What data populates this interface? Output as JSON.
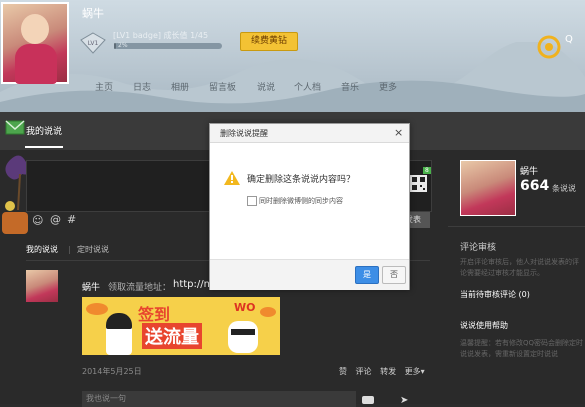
{
  "header": {
    "username": "蜗牛",
    "level_text": "[LV1 badge] 成长值 1/45",
    "progress_label": "2%",
    "progress_value": 0.02,
    "renew_button": "续费黄钻",
    "nav": [
      "主页",
      "日志",
      "相册",
      "留言板",
      "说说",
      "个人档",
      "音乐",
      "更多"
    ],
    "logo_text": "Q"
  },
  "tabs": {
    "my_shuoshuo": "我的说说"
  },
  "composer": {
    "tools": {
      "emoji": "☺",
      "at": "@",
      "topic": "#"
    },
    "publish": "发表",
    "qr_badge": "8"
  },
  "filters": {
    "mine": "我的说说",
    "sep": "|",
    "scheduled": "定时说说"
  },
  "post": {
    "name": "蜗牛",
    "text": "领取流量地址：",
    "link": "http://mqzone.com/rg-0/23",
    "banner": {
      "title1": "签到",
      "title2": "送流量",
      "brand": "WO"
    },
    "date": "2014年5月25日",
    "actions": [
      "赞",
      "评论",
      "转发",
      "更多▾"
    ],
    "comment_placeholder": "我也说一句"
  },
  "side": {
    "name": "蜗牛",
    "count": "664",
    "count_label": "条说说",
    "review_title": "评论审核",
    "review_desc": "开启评论审核后，他人对说说发表的评论需要经过审核才能显示。",
    "pending": "当前待审核评论 (0)",
    "help_title": "说说使用帮助",
    "help_desc": "温馨提醒：若有修改QQ密码会删除定时说说发表，需重新设置定时说说"
  },
  "dialog": {
    "title": "删除说说提醒",
    "close": "×",
    "question": "确定删除这条说说内容吗？",
    "checkbox_label": "同时删除微博侧的同步内容",
    "yes": "是",
    "no": "否"
  }
}
